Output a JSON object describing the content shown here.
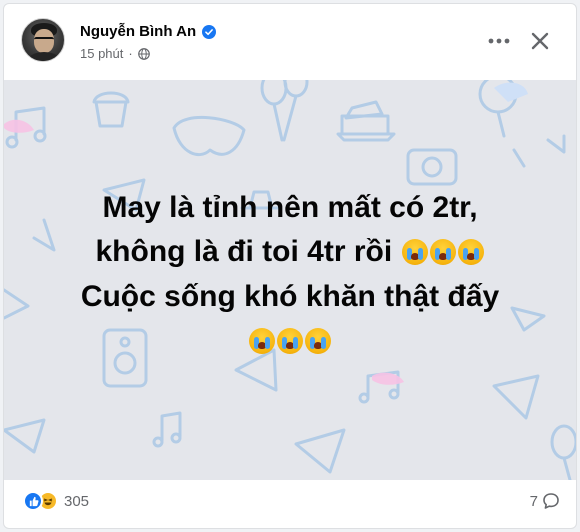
{
  "post": {
    "author_name": "Nguyễn Bình An",
    "timestamp": "15 phút",
    "privacy_icon": "globe-icon",
    "verified_icon": "verified-badge-icon",
    "text_lines": [
      "May là tỉnh nên mất có 2tr,",
      "không là đi toi 4tr rồi",
      "Cuộc sống khó khăn thật đấy"
    ],
    "emoji_line2": "😭😭😭",
    "emoji_line4": "😭😭😭",
    "background_color": "#e4e6eb"
  },
  "footer": {
    "reaction_icons": [
      "like-icon",
      "haha-icon"
    ],
    "reaction_count": "305",
    "comment_count": "7",
    "comment_icon": "comment-icon"
  },
  "colors": {
    "verified": "#1877f2",
    "like": "#1877f2",
    "haha": "#f7b928",
    "secondary_text": "#65676b"
  }
}
